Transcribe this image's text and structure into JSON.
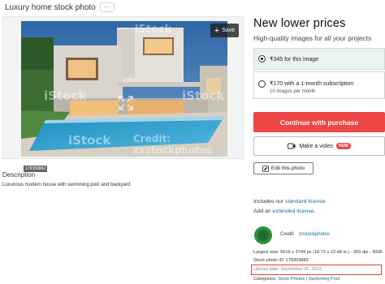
{
  "page": {
    "title": "Luxury home stock photo",
    "more_label": "···"
  },
  "image": {
    "save_label": "Save",
    "watermark": "iStock",
    "photo_id": "178359882",
    "credit_on_image": "Credit: zxstockphotos"
  },
  "description": {
    "heading": "Description",
    "text": "Luxurious modern house with swimming pool and backyard"
  },
  "pricing": {
    "heading": "New lower prices",
    "subheading": "High-quality images for all your projects",
    "options": [
      {
        "label": "₹345 for this image",
        "sub": "",
        "selected": true
      },
      {
        "label": "₹170 with a 1-month subscription",
        "sub": "10 images per month",
        "selected": false
      }
    ],
    "cta_label": "Continue with purchase"
  },
  "actions": {
    "video_label": "Make a video",
    "video_badge": "NEW",
    "edit_label": "Edit this photo"
  },
  "license": {
    "line1_prefix": "Includes our ",
    "line1_link": "standard license.",
    "line2_prefix": "Add an ",
    "line2_link": "extended license."
  },
  "credit": {
    "label": "Credit:",
    "name": "zxstockphotos"
  },
  "meta": {
    "size": "Largest size: 5616 x 3744 px (18.72 x 12.48 in.) - 300 dpi - RGB",
    "stock_id": "Stock photo ID: 178359882",
    "upload_date": "Upload date: September 05, 2012",
    "categories_label": "Categories: ",
    "categories": "Stock Photos | Swimming Pool"
  },
  "colors": {
    "accent_red": "#ef4646",
    "link_teal": "#0b6f8e"
  }
}
